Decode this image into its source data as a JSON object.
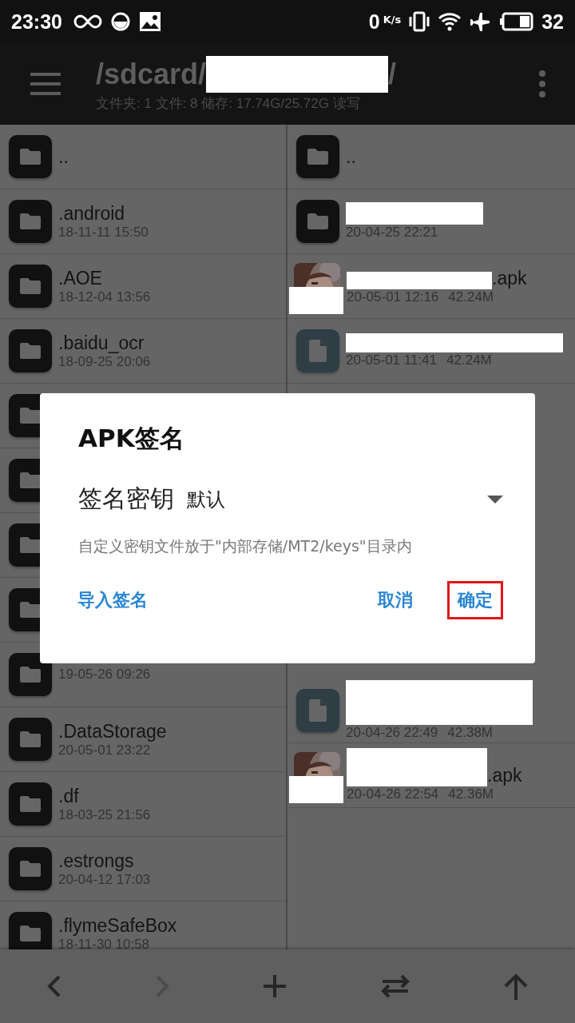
{
  "status_bar": {
    "time": "23:30",
    "net_speed": "0",
    "net_unit": "K/s",
    "battery": "32"
  },
  "toolbar": {
    "path_prefix": "/sdcard/",
    "path_redacted": true,
    "path_suffix": "/",
    "info": "文件夹: 1  文件: 8  储存: 17.74G/25.72G  读写"
  },
  "left_pane": {
    "items": [
      {
        "kind": "folder",
        "name": ".."
      },
      {
        "kind": "folder",
        "name": ".android",
        "date": "18-11-11 15:50"
      },
      {
        "kind": "folder",
        "name": ".AOE",
        "date": "18-12-04 13:56"
      },
      {
        "kind": "folder",
        "name": ".baidu_ocr",
        "date": "18-09-25 20:06"
      },
      {
        "kind": "folder"
      },
      {
        "kind": "folder"
      },
      {
        "kind": "folder"
      },
      {
        "kind": "folder"
      },
      {
        "kind": "folder",
        "date": "19-05-26 09:26"
      },
      {
        "kind": "folder",
        "name": ".DataStorage",
        "date": "20-05-01 23:22"
      },
      {
        "kind": "folder",
        "name": ".df",
        "date": "18-03-25 21:56"
      },
      {
        "kind": "folder",
        "name": ".estrongs",
        "date": "20-04-12 17:03"
      },
      {
        "kind": "folder",
        "name": ".flymeSafeBox",
        "date": "18-11-30 10:58"
      }
    ]
  },
  "right_pane": {
    "items": [
      {
        "kind": "folder",
        "name": ".."
      },
      {
        "kind": "folder",
        "name_redacted": true,
        "date": "20-04-25 22:21"
      },
      {
        "kind": "apk",
        "name_redacted": true,
        "name": ".apk",
        "icon_redacted": true,
        "date": "20-05-01 12:16",
        "size": "42.24M"
      },
      {
        "kind": "file",
        "name_redacted": true,
        "date": "20-05-01 11:41",
        "size": "42.24M"
      },
      {
        "kind": "gap"
      },
      {
        "kind": "file",
        "name_redacted": true,
        "tall": true,
        "date": "20-04-26 22:49",
        "size": "42.38M"
      },
      {
        "kind": "apk",
        "name_redacted": true,
        "name": ".apk",
        "icon_redacted": true,
        "tall": true,
        "date": "20-04-26 22:54",
        "size": "42.36M"
      }
    ]
  },
  "dialog": {
    "title": "APK签名",
    "key_label": "签名密钥",
    "key_value": "默认",
    "hint": "自定义密钥文件放于\"内部存储/MT2/keys\"目录内",
    "buttons": [
      {
        "label": "导入签名",
        "highlighted": false
      },
      {
        "label": "取消",
        "highlighted": false
      },
      {
        "label": "确定",
        "highlighted": true
      }
    ]
  },
  "bottom_bar": {
    "buttons": [
      {
        "kind": "back",
        "disabled": false
      },
      {
        "kind": "forward",
        "disabled": true
      },
      {
        "kind": "add",
        "disabled": false
      },
      {
        "kind": "swap",
        "disabled": false
      },
      {
        "kind": "up",
        "disabled": false
      }
    ]
  }
}
